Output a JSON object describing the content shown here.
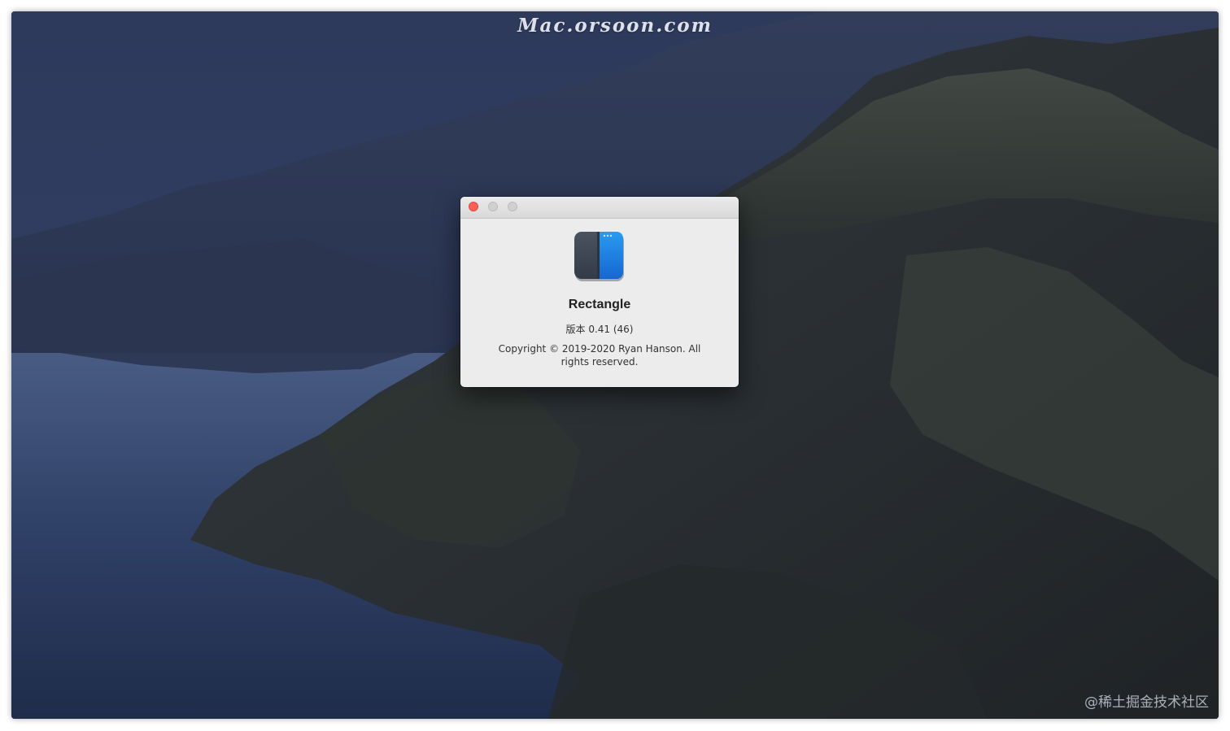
{
  "watermarks": {
    "top": "Mac.orsoon.com",
    "bottom": "@稀土掘金技术社区"
  },
  "about_window": {
    "buttons": {
      "close": "close",
      "minimize": "minimize",
      "zoom": "zoom"
    },
    "app_icon": "rectangle-app-icon",
    "app_name": "Rectangle",
    "version": "版本 0.41 (46)",
    "copyright": "Copyright © 2019-2020 Ryan Hanson. All rights reserved."
  },
  "colors": {
    "close_button": "#fc5f57",
    "inactive_button": "#d0d0d0",
    "window_background": "#ececec",
    "icon_dark": "#3e4756",
    "icon_blue": "#1a7ce3"
  }
}
